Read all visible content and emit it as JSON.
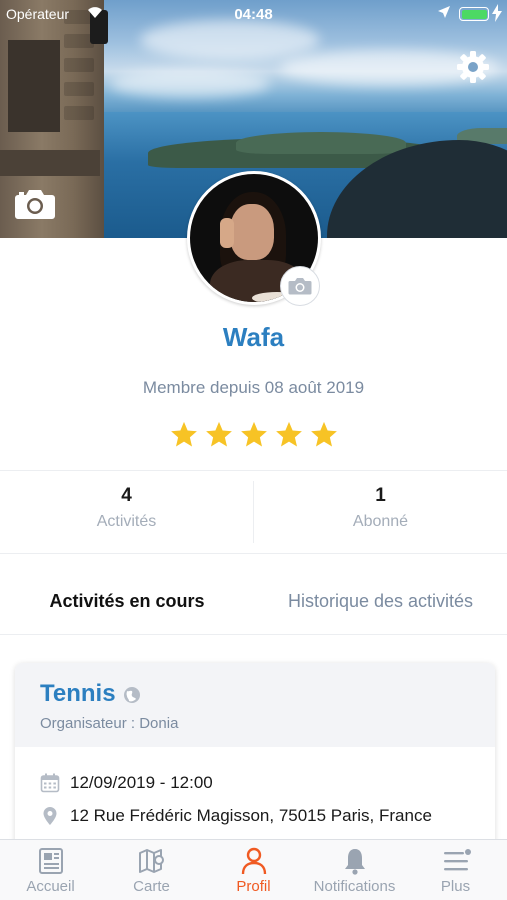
{
  "status_bar": {
    "carrier": "Opérateur",
    "time": "04:48"
  },
  "profile": {
    "name": "Wafa",
    "member_since": "Membre depuis 08 août 2019",
    "rating": 5,
    "rating_max": 5
  },
  "stats": [
    {
      "value": "4",
      "label": "Activités"
    },
    {
      "value": "1",
      "label": "Abonné"
    }
  ],
  "tabs": [
    {
      "label": "Activités en cours",
      "active": true
    },
    {
      "label": "Historique des activités",
      "active": false
    }
  ],
  "activity": {
    "title": "Tennis",
    "organizer": "Organisateur : Donia",
    "datetime": "12/09/2019 - 12:00",
    "address": "12 Rue Frédéric Magisson, 75015 Paris, France"
  },
  "tabbar": [
    {
      "label": "Accueil",
      "icon": "newspaper-icon"
    },
    {
      "label": "Carte",
      "icon": "map-icon"
    },
    {
      "label": "Profil",
      "icon": "person-icon",
      "active": true
    },
    {
      "label": "Notifications",
      "icon": "bell-icon"
    },
    {
      "label": "Plus",
      "icon": "menu-icon"
    }
  ],
  "colors": {
    "accent": "#f05a22",
    "brand_blue": "#2c7fc0",
    "muted": "#7b8ba0",
    "star": "#f7c325",
    "battery": "#4cd964"
  }
}
